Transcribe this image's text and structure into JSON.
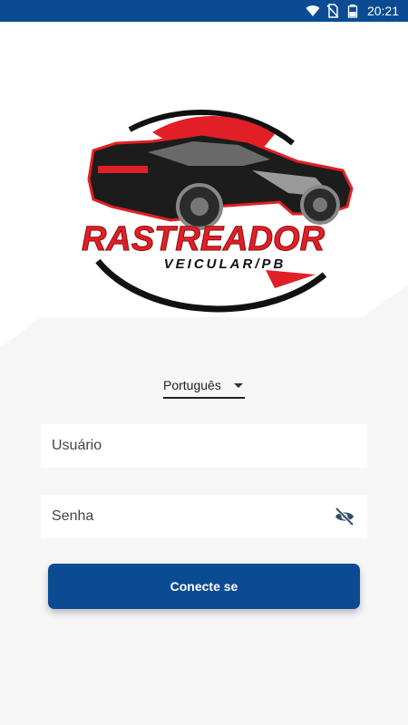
{
  "status_bar": {
    "time": "20:21",
    "icons": [
      "wifi-icon",
      "no-sim-icon",
      "battery-icon"
    ],
    "background_color": "#0b4b93"
  },
  "logo": {
    "brand_line1": "RASTREADOR",
    "brand_line2": "VEICULAR/PB",
    "accent_color": "#e21f26"
  },
  "language_selector": {
    "selected": "Português",
    "icon": "caret-down-icon"
  },
  "form": {
    "username_placeholder": "Usuário",
    "username_value": "",
    "password_placeholder": "Senha",
    "password_value": "",
    "password_toggle_icon": "eye-off-icon"
  },
  "login_button": {
    "label": "Conecte se",
    "color": "#0b4b93"
  }
}
